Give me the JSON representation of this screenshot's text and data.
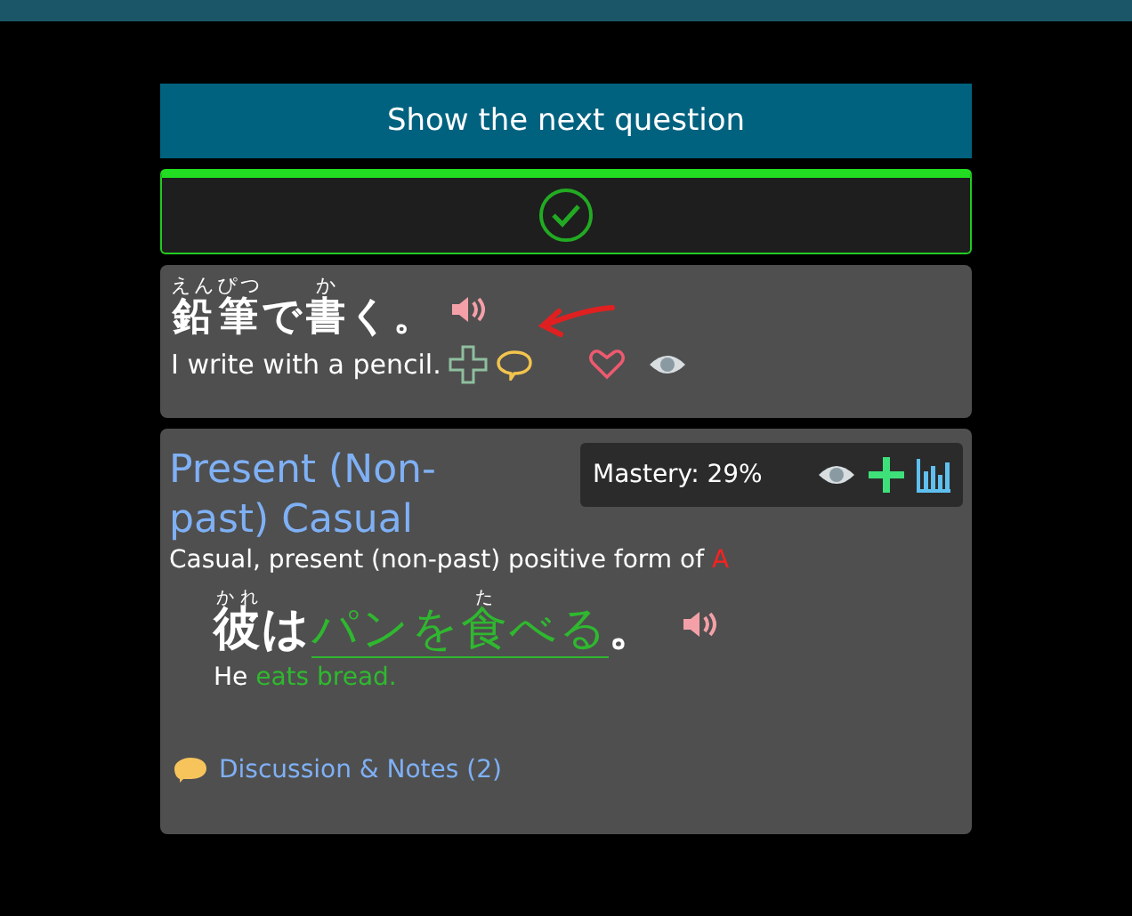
{
  "next_button": "Show the next question",
  "result": {
    "correct": true
  },
  "question": {
    "sentence": [
      {
        "text": "鉛",
        "reading": "えん"
      },
      {
        "text": "筆",
        "reading": "ぴつ"
      },
      {
        "text": "で"
      },
      {
        "text": "書",
        "reading": "か"
      },
      {
        "text": "く。"
      }
    ],
    "translation": "I write with a pencil."
  },
  "grammar": {
    "title": "Present (Non-past) Casual",
    "mastery": "Mastery: 29%",
    "description": "Casual, present (non-past) positive form of",
    "description_link": "A",
    "example": [
      {
        "text": "彼",
        "reading": "かれ",
        "highlight": false
      },
      {
        "text": "は",
        "highlight": false
      },
      {
        "text": "パンを",
        "highlight": true
      },
      {
        "text": "食",
        "reading": "た",
        "highlight": true
      },
      {
        "text": "べる",
        "highlight": true
      },
      {
        "text": "。",
        "highlight": false
      }
    ],
    "translation": [
      {
        "text": "He",
        "highlight": false
      },
      {
        "text": "eats bread.",
        "highlight": true
      }
    ],
    "discussion": "Discussion & Notes (2)"
  }
}
